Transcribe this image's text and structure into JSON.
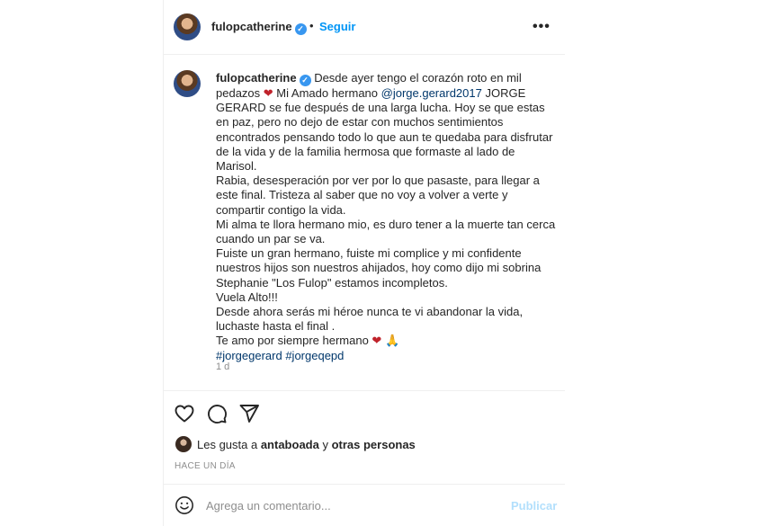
{
  "header": {
    "username": "fulopcatherine",
    "separator": "•",
    "follow_label": "Seguir",
    "more_icon": "more-horizontal-icon"
  },
  "caption": {
    "username": "fulopcatherine",
    "lines": [
      {
        "text_before": " Desde ayer tengo el corazón roto en mil pedazos ",
        "heart": "❤",
        "text_mid": " Mi Amado hermano ",
        "mention": "@jorge.gerard2017",
        "text_after": " JORGE GERARD se fue después de una larga lucha. Hoy se que estas en paz, pero no dejo de estar con muchos sentimientos encontrados pensando todo lo que aun te quedaba para disfrutar de la vida y de la familia hermosa que formaste al lado de Marisol."
      }
    ],
    "paragraphs": [
      "Rabia, desesperación por ver por lo que pasaste, para llegar a este final. Tristeza al saber que no voy a volver a verte y compartir contigo la vida.",
      "Mi alma te llora hermano mio, es duro tener a la muerte tan cerca cuando un par se va.",
      "Fuiste un gran hermano, fuiste mi complice y mi confidente nuestros hijos son nuestros ahijados, hoy como dijo mi sobrina Stephanie \"Los Fulop\" estamos incompletos.",
      "Vuela Alto!!!",
      "Desde ahora serás mi héroe nunca te vi abandonar la vida, luchaste hasta el final ."
    ],
    "closing": "Te amo por siempre hermano ",
    "closing_heart": "❤",
    "closing_hands": "🙏",
    "hashtags": "#jorgegerard #jorgeqepd",
    "time": "1 d"
  },
  "actions": {
    "like_icon": "heart-icon",
    "comment_icon": "comment-icon",
    "share_icon": "send-icon"
  },
  "likes": {
    "prefix": "Les gusta a ",
    "user": "antaboada",
    "middle": " y ",
    "others": "otras personas"
  },
  "timestamp": "HACE UN DÍA",
  "comment": {
    "placeholder": "Agrega un comentario...",
    "publish_label": "Publicar",
    "emoji_icon": "smiley-icon"
  },
  "colors": {
    "link": "#00376b",
    "follow": "#0095f6",
    "publish_disabled": "#b2dffc",
    "verified": "#3897f0",
    "secondary_text": "#8e8e8e"
  }
}
